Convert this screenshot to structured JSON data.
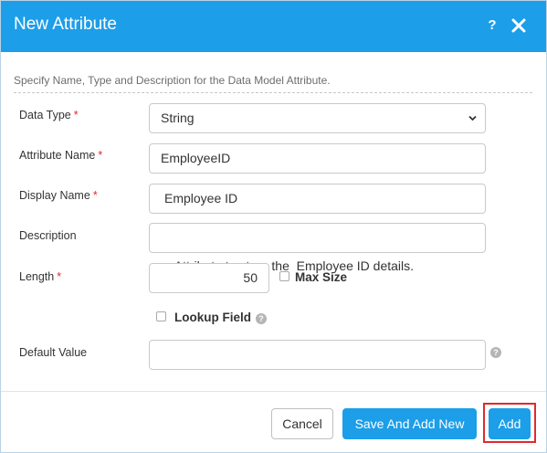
{
  "dialog": {
    "title": "New Attribute",
    "help_icon": "question-mark-icon",
    "close_icon": "close-x-icon",
    "instructions": "Specify Name, Type and Description for the Data Model Attribute.",
    "required_marker": "*"
  },
  "fields": {
    "data_type": {
      "label": "Data Type",
      "value": "String",
      "required": true
    },
    "attribute_name": {
      "label": "Attribute Name",
      "value": "EmployeeID",
      "required": true
    },
    "display_name": {
      "label": "Display Name",
      "value": "Employee ID",
      "required": true
    },
    "description": {
      "label": "Description",
      "value": "Attribute to store the  Employee ID details.",
      "required": false
    },
    "length": {
      "label": "Length",
      "value": "50",
      "required": true
    },
    "max_size": {
      "label": "Max Size",
      "checked": false
    },
    "lookup_field": {
      "label": "Lookup Field",
      "checked": false
    },
    "default_value": {
      "label": "Default Value",
      "value": "",
      "required": false
    }
  },
  "buttons": {
    "cancel": "Cancel",
    "save_and_add_new": "Save And Add New",
    "add": "Add"
  },
  "colors": {
    "header_bg": "#1c9ee8",
    "primary_button": "#1c9ee8",
    "required": "#e0292f",
    "highlight": "#e0292f"
  }
}
